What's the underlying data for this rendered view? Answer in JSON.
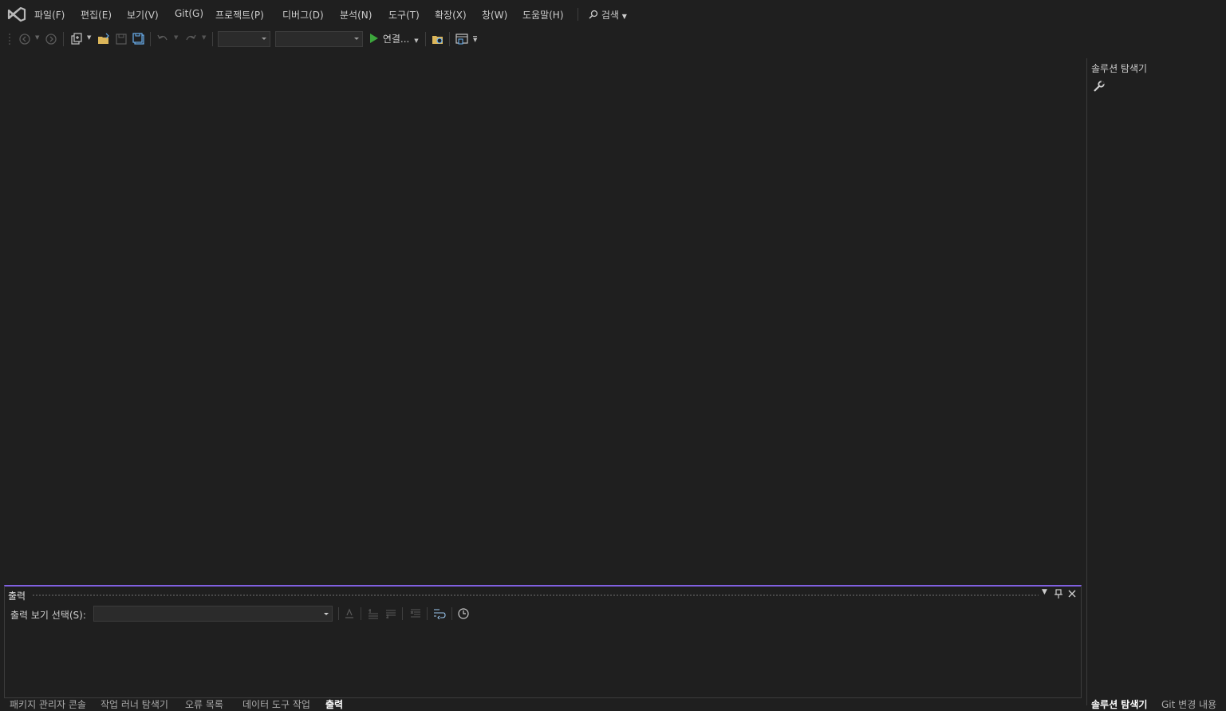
{
  "menu": {
    "items": [
      "파일(F)",
      "편집(E)",
      "보기(V)",
      "Git(G)",
      "프로젝트(P)",
      "디버그(D)",
      "분석(N)",
      "도구(T)",
      "확장(X)",
      "창(W)",
      "도움말(H)"
    ],
    "search_label": "검색"
  },
  "toolbar": {
    "run_label": "연결...",
    "config_value": "",
    "platform_value": ""
  },
  "solution_explorer": {
    "title": "솔루션 탐색기"
  },
  "output": {
    "title": "출력",
    "source_label": "출력 보기 선택(S):",
    "source_value": ""
  },
  "bottom_tabs": {
    "items": [
      "패키지 관리자 콘솔",
      "작업 러너 탐색기",
      "오류 목록",
      "데이터 도구 작업",
      "출력"
    ],
    "active": "출력"
  },
  "right_tabs": {
    "items": [
      "솔루션 탐색기",
      "Git 변경 내용"
    ]
  },
  "colors": {
    "background": "#1f1f1f",
    "accent": "#8060e0",
    "run_green": "#3ca63c",
    "text": "#cccccc"
  }
}
